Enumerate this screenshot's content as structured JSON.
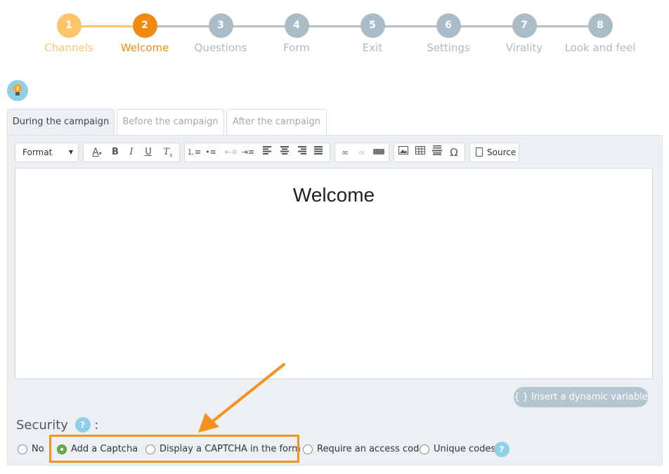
{
  "stepper": {
    "steps": [
      {
        "num": "1",
        "label": "Channels"
      },
      {
        "num": "2",
        "label": "Welcome"
      },
      {
        "num": "3",
        "label": "Questions"
      },
      {
        "num": "4",
        "label": "Form"
      },
      {
        "num": "5",
        "label": "Exit"
      },
      {
        "num": "6",
        "label": "Settings"
      },
      {
        "num": "7",
        "label": "Virality"
      },
      {
        "num": "8",
        "label": "Look and feel"
      }
    ],
    "active_step": "2",
    "colors": {
      "done": "#fcc56b",
      "active": "#f08a12",
      "pending": "#a9bcc7"
    }
  },
  "tabs": [
    {
      "label": "During the campaign"
    },
    {
      "label": "Before the campaign"
    },
    {
      "label": "After the campaign"
    }
  ],
  "toolbar": {
    "format_label": "Format",
    "source_label": "Source",
    "icons": [
      "text-color-icon",
      "bold-icon",
      "italic-icon",
      "underline-icon",
      "remove-format-icon",
      "numbered-list-icon",
      "bulleted-list-icon",
      "outdent-icon",
      "indent-icon",
      "align-left-icon",
      "align-center-icon",
      "align-right-icon",
      "justify-icon",
      "link-icon",
      "unlink-icon",
      "anchor-icon",
      "image-icon",
      "table-icon",
      "horizontal-line-icon",
      "special-char-icon",
      "source-icon"
    ]
  },
  "editor": {
    "heading": "Welcome"
  },
  "dynamic_variable_button": "{ } Insert a dynamic variable",
  "security": {
    "title": "Security",
    "separator": ":",
    "help": "?",
    "options": [
      {
        "label": "No",
        "checked": false
      },
      {
        "label": "Add a Captcha",
        "checked": true
      },
      {
        "label": "Display a CAPTCHA in the form",
        "checked": false
      },
      {
        "label": "Require an access code",
        "checked": false
      },
      {
        "label": "Unique codes",
        "checked": false
      }
    ],
    "checked_color": "#6aae45"
  },
  "annotation": {
    "color": "#f5921e"
  }
}
